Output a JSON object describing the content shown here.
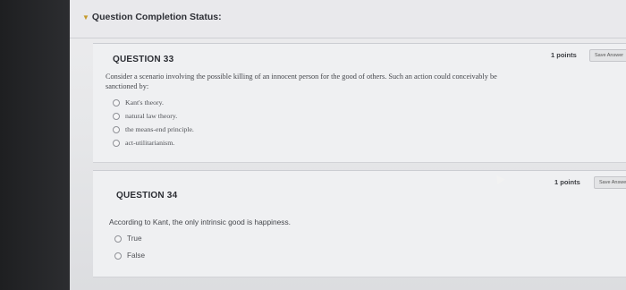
{
  "status": {
    "title": "Question Completion Status:"
  },
  "questions": [
    {
      "title": "QUESTION 33",
      "points": "1 points",
      "save": "Save Answer",
      "prompt": "Consider a scenario involving the possible killing of an innocent person for the good of others. Such an action could conceivably be sanctioned by:",
      "options": [
        "Kant's theory.",
        "natural law theory.",
        "the means-end principle.",
        "act-utilitarianism."
      ]
    },
    {
      "title": "QUESTION 34",
      "points": "1 points",
      "save": "Save Answer",
      "prompt": "According to Kant, the only intrinsic good is happiness.",
      "options": [
        "True",
        "False"
      ]
    }
  ]
}
